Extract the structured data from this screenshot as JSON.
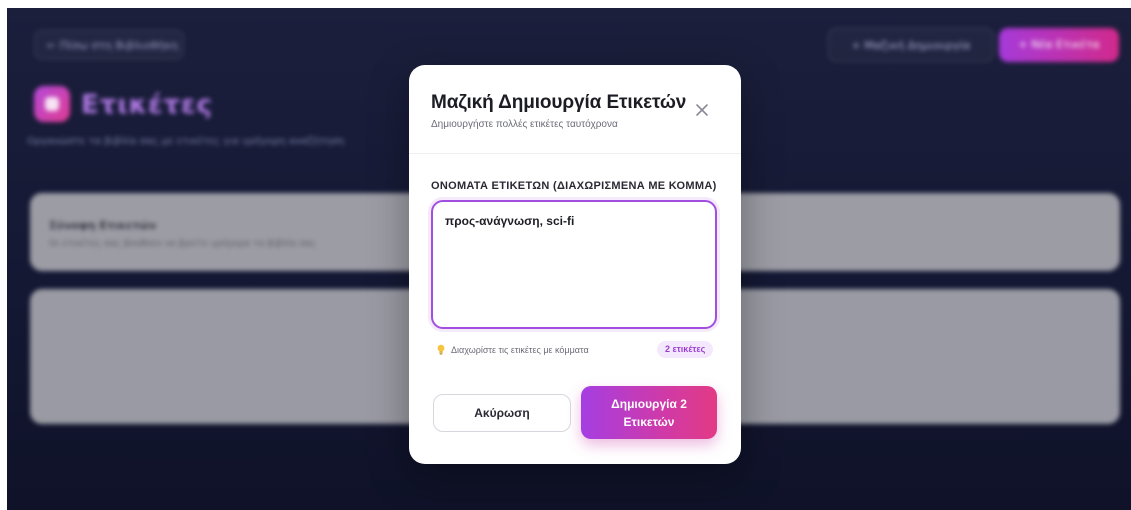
{
  "background": {
    "back_button": "← Πίσω στη Βιβλιοθήκη",
    "secondary_button": "+ Μαζική Δημιουργία",
    "primary_button": "+ Νέα Ετικέτα",
    "page_title": "Ετικέτες",
    "page_subtitle": "Οργανώστε τα βιβλία σας με ετικέτες για γρήγορη αναζήτηση",
    "card_title": "Σύνοψη Ετικετών",
    "card_description": "Οι ετικέτες σας βοηθούν να βρείτε γρήγορα τα βιβλία σας"
  },
  "modal": {
    "title": "Μαζική Δημιουργία Ετικετών",
    "subtitle": "Δημιουργήστε πολλές ετικέτες ταυτόχρονα",
    "field_label": "ΟΝΟΜΑΤΑ ΕΤΙΚΕΤΩΝ (ΔΙΑΧΩΡΙΣΜΕΝΑ ΜΕ ΚΟΜΜΑ)",
    "textarea_value": "προς-ανάγνωση, sci-fi",
    "hint": "Διαχωρίστε τις ετικέτες με κόμματα",
    "count_badge": "2 ετικέτες",
    "cancel_label": "Ακύρωση",
    "create_label": "Δημιουργία 2 Ετικετών"
  },
  "colors": {
    "accent": "#a24fe0",
    "accent_gradient_end": "#e23a85",
    "backdrop": "#141833"
  },
  "icons": {
    "close": "close-icon",
    "hint": "lightbulb-icon",
    "page": "tag-icon"
  }
}
